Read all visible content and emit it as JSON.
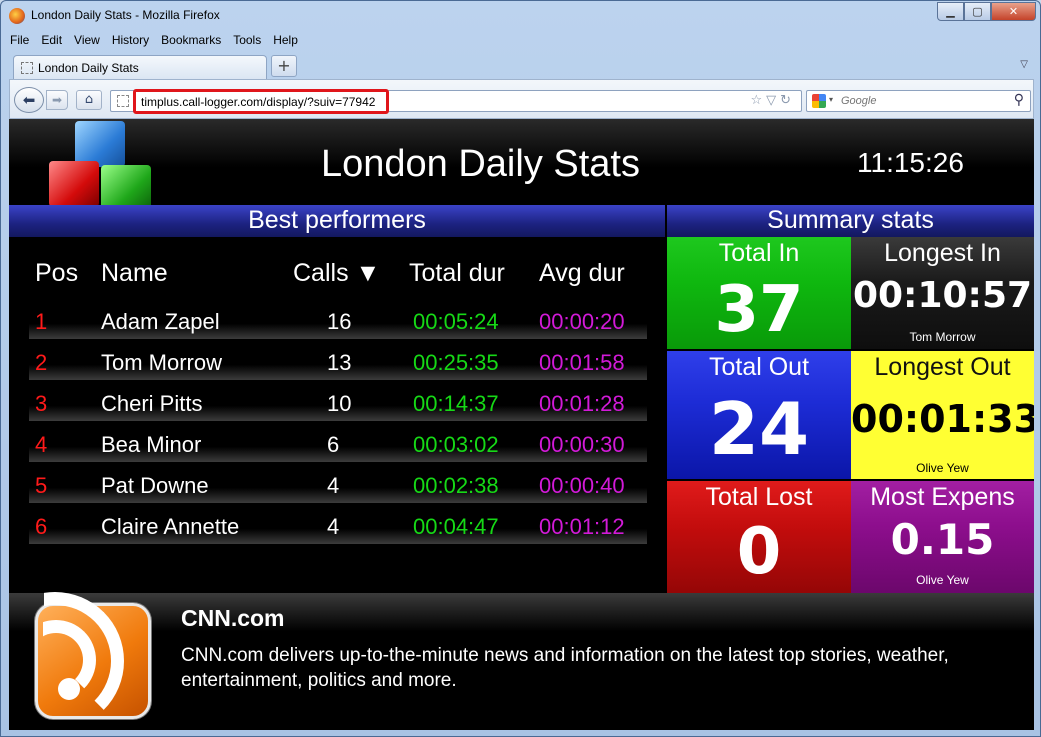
{
  "window": {
    "title": "London Daily Stats - Mozilla Firefox",
    "controls": {
      "minimize": "▁",
      "maximize": "▢",
      "close": "✕"
    }
  },
  "menu": [
    "File",
    "Edit",
    "View",
    "History",
    "Bookmarks",
    "Tools",
    "Help"
  ],
  "tabs": [
    {
      "label": "London Daily Stats"
    }
  ],
  "new_tab_label": "+",
  "tab_list_glyph": "▽",
  "nav": {
    "back_glyph": "⬅",
    "forward_glyph": "➡",
    "home_glyph": "⌂",
    "url": "timplus.call-logger.com/display/?suiv=77942",
    "url_icons": "☆▽↻",
    "search_placeholder": "Google",
    "search_glyph": "⚲",
    "search_engine_caret": "▾"
  },
  "page": {
    "title": "London Daily Stats",
    "clock": "11:15:26",
    "best_performers_title": "Best performers",
    "summary_title": "Summary stats",
    "table": {
      "headers": {
        "pos": "Pos",
        "name": "Name",
        "calls": "Calls ▼",
        "total": "Total dur",
        "avg": "Avg dur"
      },
      "rows": [
        {
          "pos": "1",
          "name": "Adam Zapel",
          "calls": "16",
          "total": "00:05:24",
          "avg": "00:00:20"
        },
        {
          "pos": "2",
          "name": "Tom Morrow",
          "calls": "13",
          "total": "00:25:35",
          "avg": "00:01:58"
        },
        {
          "pos": "3",
          "name": "Cheri Pitts",
          "calls": "10",
          "total": "00:14:37",
          "avg": "00:01:28"
        },
        {
          "pos": "4",
          "name": "Bea Minor",
          "calls": "6",
          "total": "00:03:02",
          "avg": "00:00:30"
        },
        {
          "pos": "5",
          "name": "Pat Downe",
          "calls": "4",
          "total": "00:02:38",
          "avg": "00:00:40"
        },
        {
          "pos": "6",
          "name": "Claire Annette",
          "calls": "4",
          "total": "00:04:47",
          "avg": "00:01:12"
        }
      ]
    },
    "stats": {
      "total_in": {
        "label": "Total In",
        "value": "37"
      },
      "longest_in": {
        "label": "Longest In",
        "value": "00:10:57",
        "who": "Tom Morrow"
      },
      "total_out": {
        "label": "Total Out",
        "value": "24"
      },
      "longest_out": {
        "label": "Longest Out",
        "value": "00:01:33",
        "who": "Olive Yew"
      },
      "total_lost": {
        "label": "Total Lost",
        "value": "0"
      },
      "most_expens": {
        "label": "Most Expens",
        "value": "0.15",
        "who": "Olive Yew"
      }
    },
    "feed": {
      "title": "CNN.com",
      "description": "CNN.com delivers up-to-the-minute news and information on the latest top stories, weather, entertainment, politics and more."
    }
  },
  "colors": {
    "section_bar": "#1c2280",
    "total_in": "#0fb80f",
    "total_out": "#1d2cd6",
    "total_lost": "#c40d0d",
    "longest_in": "#1b1b1b",
    "longest_out": "#ffff33",
    "most_expens": "#8d0e8d",
    "pos_text": "#ff1a1a",
    "total_dur_text": "#16d916",
    "avg_dur_text": "#d21ad8",
    "url_highlight": "#e0161b"
  },
  "icons": {
    "browser": "firefox-icon",
    "logo": "cubes-logo-icon",
    "feed": "rss-icon",
    "search_engine": "google-icon"
  }
}
